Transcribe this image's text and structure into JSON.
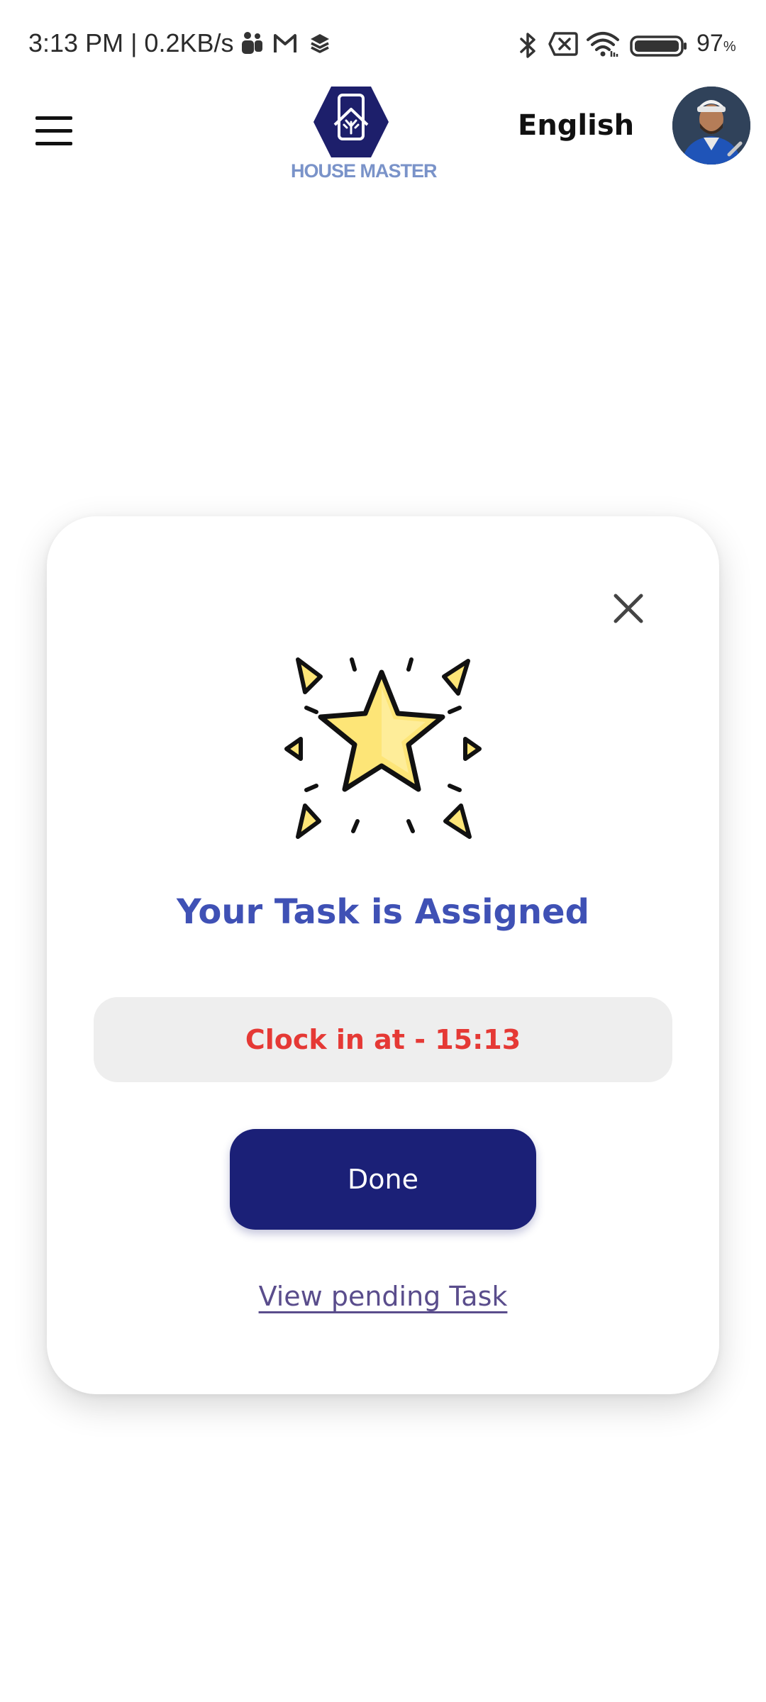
{
  "status_bar": {
    "time_speed": "3:13 PM | 0.2KB/s",
    "battery_value": "97",
    "battery_unit": "%",
    "left_icons": [
      "teams-icon",
      "gmail-icon",
      "layers-icon"
    ],
    "right_icons": [
      "bluetooth-icon",
      "no-sim-icon",
      "wifi-icon",
      "battery-icon"
    ]
  },
  "header": {
    "logo_text": "HOUSE MASTER",
    "language": "English"
  },
  "dialog": {
    "title": "Your Task is Assigned",
    "clock_in": "Clock in at - 15:13",
    "done_label": "Done",
    "pending_link": "View pending Task"
  },
  "colors": {
    "title": "#3f51b5",
    "clock_in_text": "#e53935",
    "clock_in_bg": "#eeeeee",
    "done_button": "#1b2077",
    "link": "#5a4d8c",
    "star_fill": "#fde577"
  }
}
